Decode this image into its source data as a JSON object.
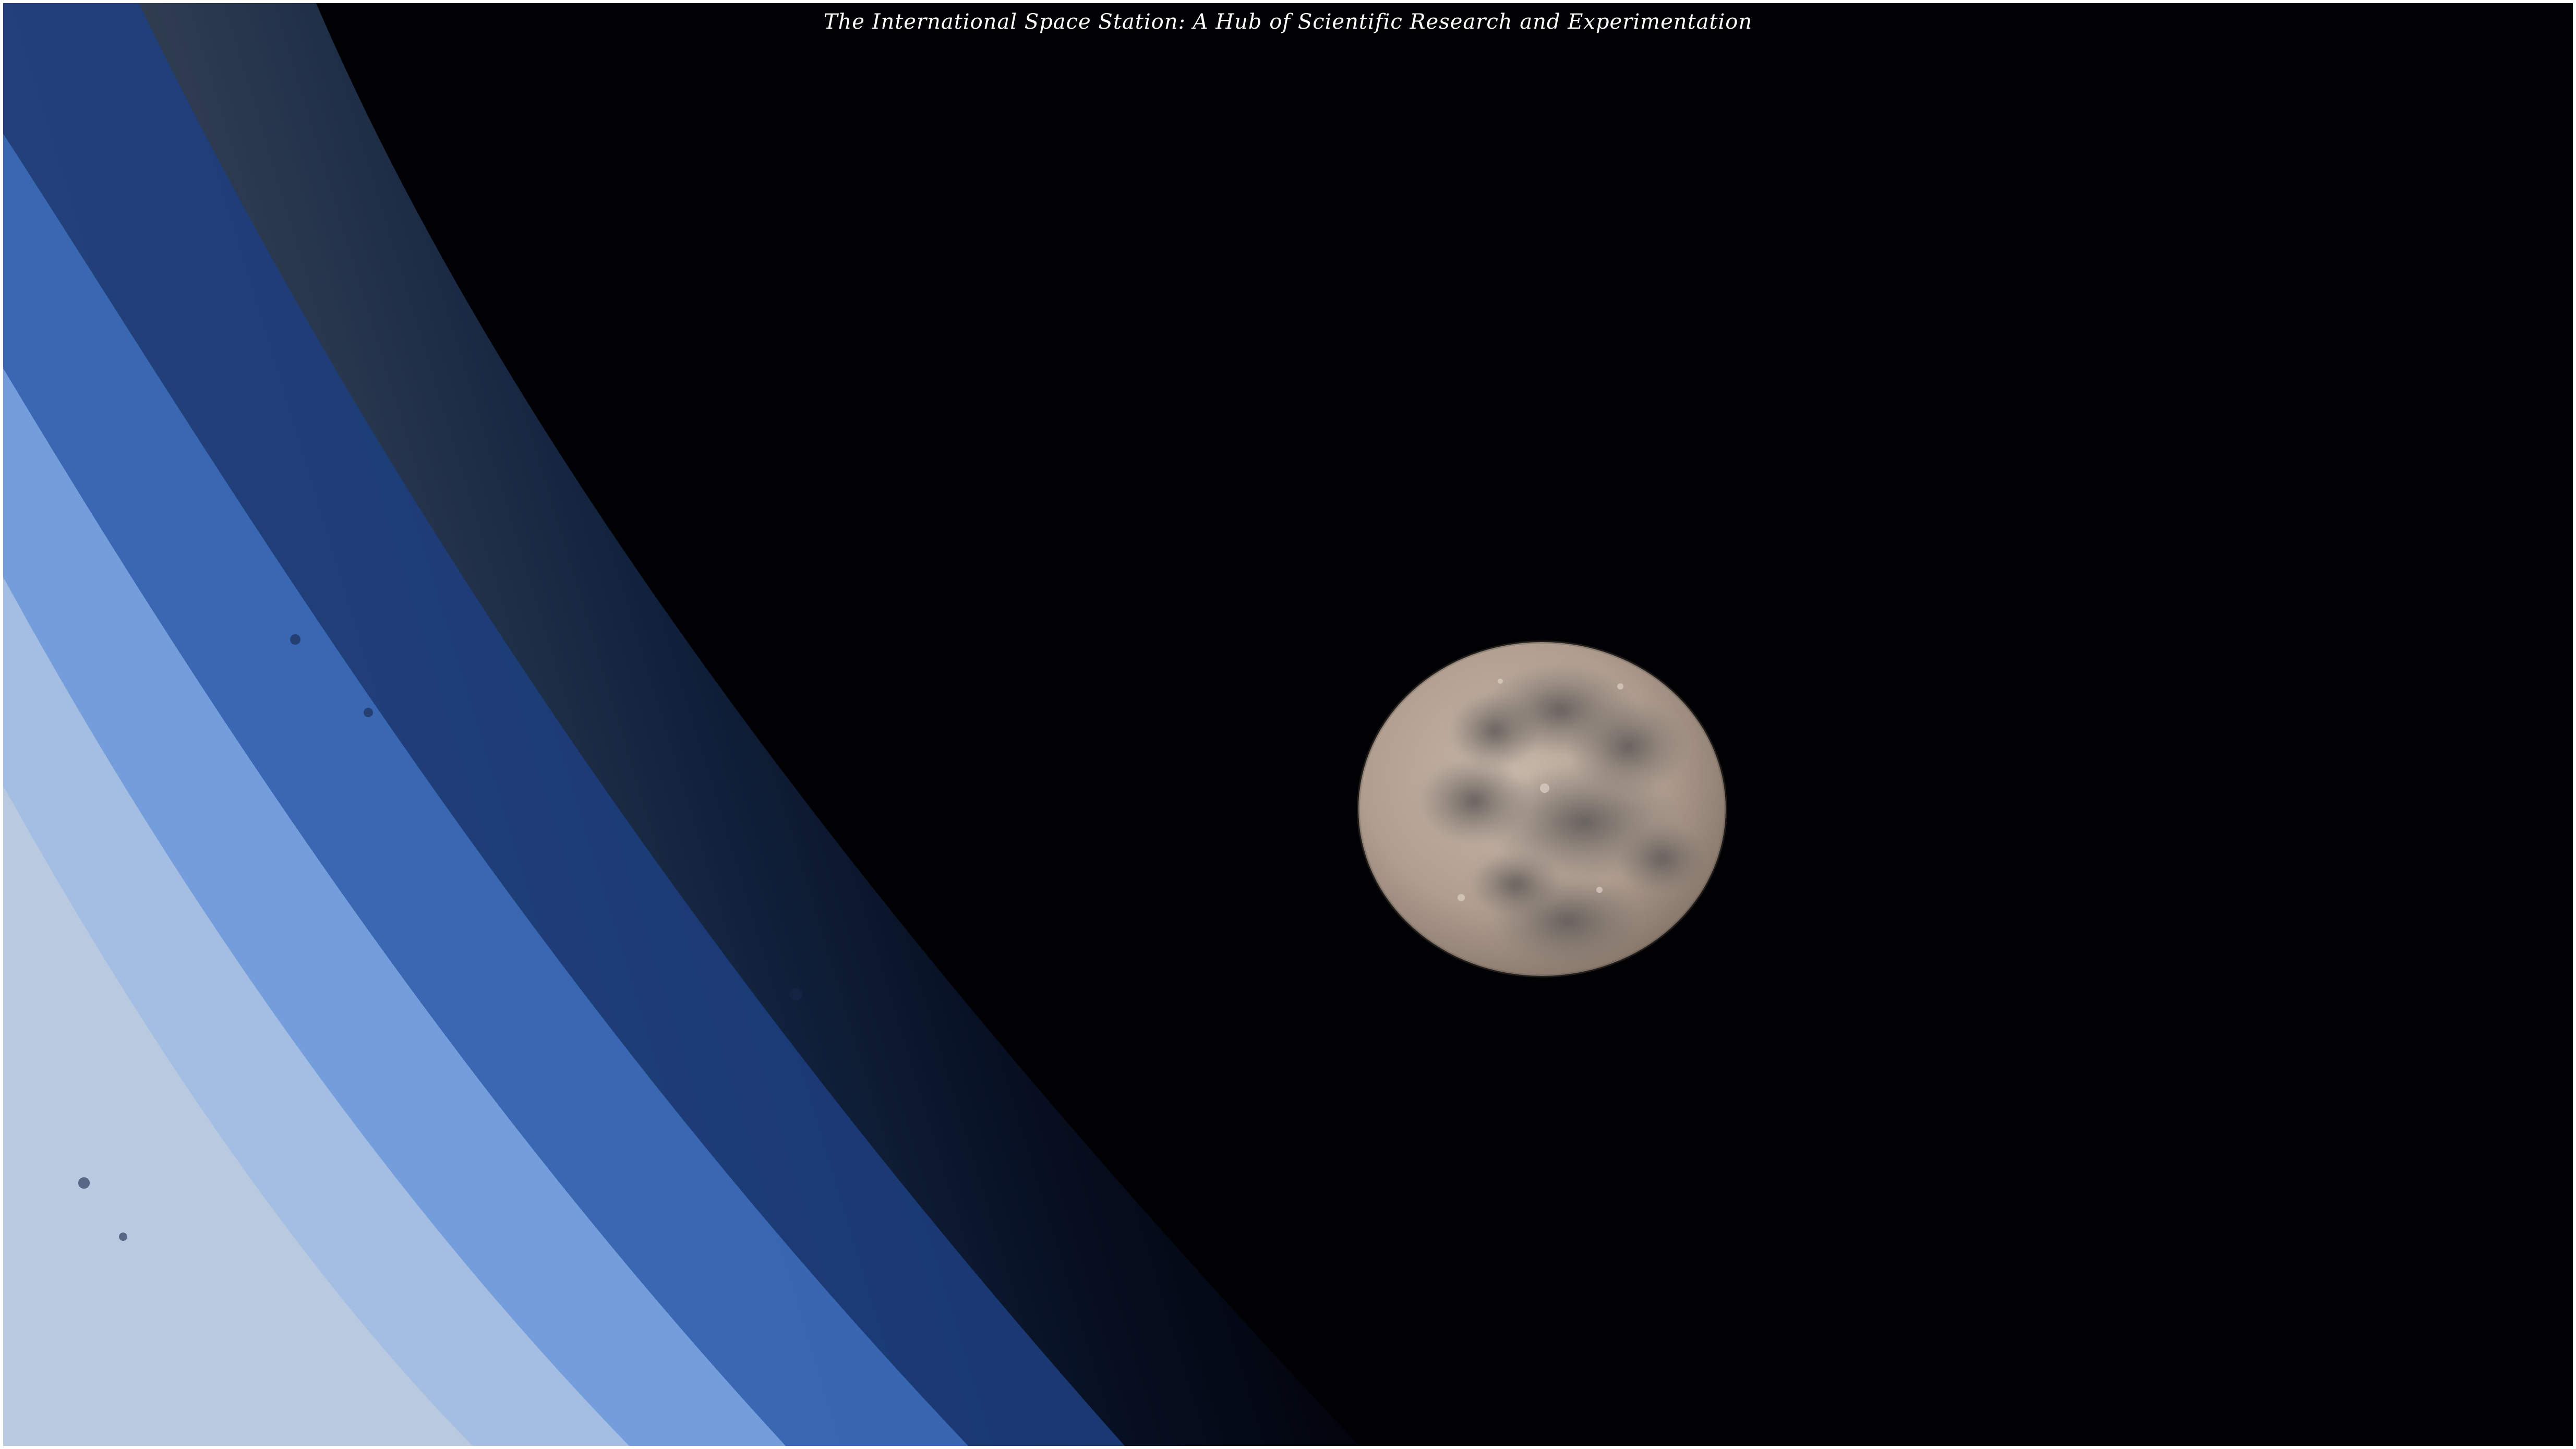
{
  "caption": "The International Space Station: A Hub of Scientific Research and Experimentation",
  "scene": {
    "subjects": [
      "earth-limb",
      "atmosphere-glow",
      "full-moon",
      "space"
    ],
    "colors": {
      "space": "#010103",
      "atmosphere_inner": "#b7c9e6",
      "atmosphere_mid": "#6f9ad8",
      "atmosphere_outer": "#1b3f7a",
      "moon_highlands": "#b4a496",
      "moon_maria": "#6e6864",
      "frame": "#ffffff"
    }
  }
}
